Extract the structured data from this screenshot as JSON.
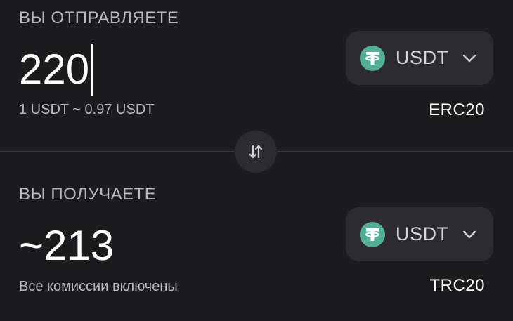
{
  "send": {
    "label": "ВЫ ОТПРАВЛЯЕТЕ",
    "amount": "220",
    "rate": "1 USDT ~ 0.97 USDT",
    "currency": "USDT",
    "network": "ERC20"
  },
  "receive": {
    "label": "ВЫ ПОЛУЧАЕТЕ",
    "amount": "~213",
    "note": "Все комиссии включены",
    "currency": "USDT",
    "network": "TRC20"
  },
  "icons": {
    "currency": "tether-icon",
    "dropdown": "chevron-down-icon",
    "swap": "swap-arrows-icon"
  },
  "colors": {
    "background": "#1c1c1e",
    "button": "#2c2c2e",
    "tether": "#53ae94",
    "muted_text": "#b9b9be"
  }
}
